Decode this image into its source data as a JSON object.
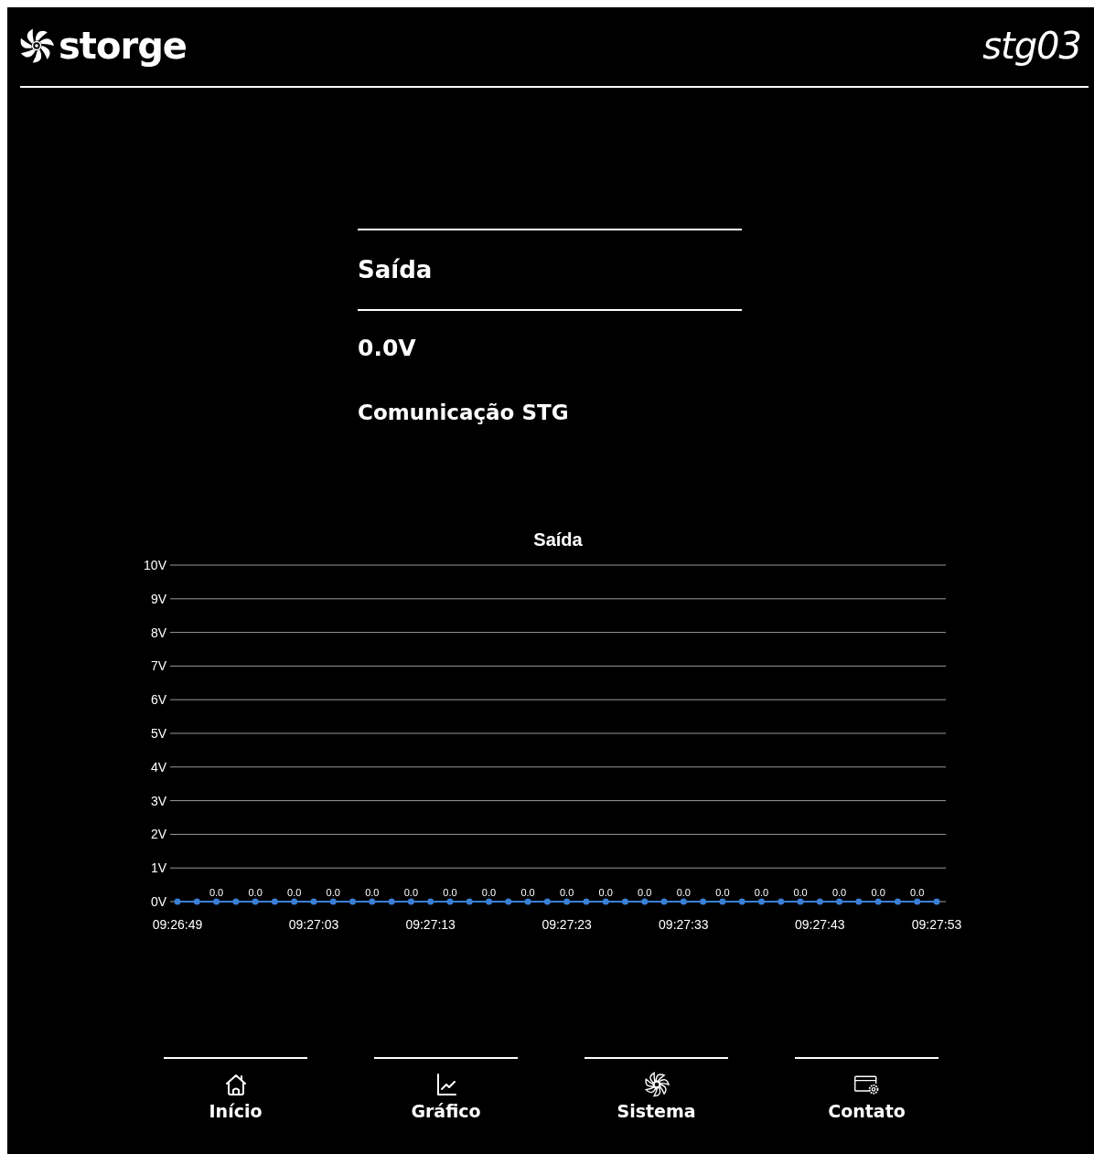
{
  "header": {
    "brand": "storge",
    "device": "stg03"
  },
  "card": {
    "title": "Saída",
    "value": "0.0V",
    "status": "Comunicação STG"
  },
  "chart_data": {
    "type": "line",
    "title": "Saída",
    "categories": [
      "09:26:49",
      null,
      null,
      null,
      null,
      null,
      null,
      "09:27:03",
      null,
      null,
      null,
      null,
      null,
      "09:27:13",
      null,
      null,
      null,
      null,
      null,
      null,
      "09:27:23",
      null,
      null,
      null,
      null,
      null,
      "09:27:33",
      null,
      null,
      null,
      null,
      null,
      null,
      "09:27:43",
      null,
      null,
      null,
      null,
      null,
      "09:27:53"
    ],
    "grid": true,
    "series": [
      {
        "color": "#3a7fd5",
        "marker": true,
        "values": [
          0,
          0,
          0,
          0,
          0,
          0,
          0,
          0,
          0,
          0,
          0,
          0,
          0,
          0,
          0,
          0,
          0,
          0,
          0,
          0,
          0,
          0,
          0,
          0,
          0,
          0,
          0,
          0,
          0,
          0,
          0,
          0,
          0,
          0,
          0,
          0,
          0,
          0,
          0,
          0
        ]
      }
    ],
    "value_labels": [
      null,
      null,
      "0.0",
      null,
      "0.0",
      null,
      "0.0",
      null,
      "0.0",
      null,
      "0.0",
      null,
      "0.0",
      null,
      "0.0",
      null,
      "0.0",
      null,
      "0.0",
      null,
      "0.0",
      null,
      "0.0",
      null,
      "0.0",
      null,
      "0.0",
      null,
      "0.0",
      null,
      "0.0",
      null,
      "0.0",
      null,
      "0.0",
      null,
      "0.0",
      null,
      "0.0",
      null
    ],
    "ylim": [
      0,
      10
    ],
    "yticks": [
      {
        "value": 0,
        "label": "0V"
      },
      {
        "value": 1,
        "label": "1V"
      },
      {
        "value": 2,
        "label": "2V"
      },
      {
        "value": 3,
        "label": "3V"
      },
      {
        "value": 4,
        "label": "4V"
      },
      {
        "value": 5,
        "label": "5V"
      },
      {
        "value": 6,
        "label": "6V"
      },
      {
        "value": 7,
        "label": "7V"
      },
      {
        "value": 8,
        "label": "8V"
      },
      {
        "value": 9,
        "label": "9V"
      },
      {
        "value": 10,
        "label": "10V"
      }
    ]
  },
  "nav": [
    {
      "label": "Início",
      "kind": "home"
    },
    {
      "label": "Gráfico",
      "kind": "chart"
    },
    {
      "label": "Sistema",
      "kind": "fan"
    },
    {
      "label": "Contato",
      "kind": "window"
    }
  ]
}
